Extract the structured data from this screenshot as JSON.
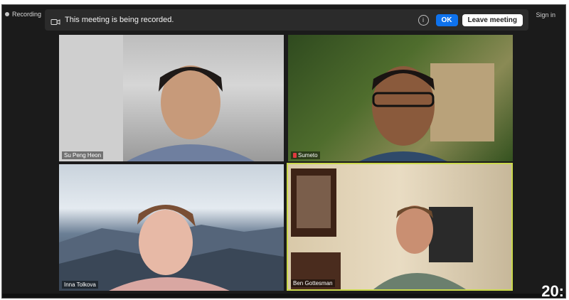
{
  "topbar": {
    "recording_label": "Recording",
    "signin_label": "Sign in"
  },
  "banner": {
    "text": "This meeting is being recorded.",
    "ok_label": "OK",
    "leave_label": "Leave meeting"
  },
  "participants": [
    {
      "name": "Su Peng Heon"
    },
    {
      "name": "Sumeto"
    },
    {
      "name": "Inna Tolkova"
    },
    {
      "name": "Ben Gottesman"
    }
  ],
  "corner_text": "20:"
}
